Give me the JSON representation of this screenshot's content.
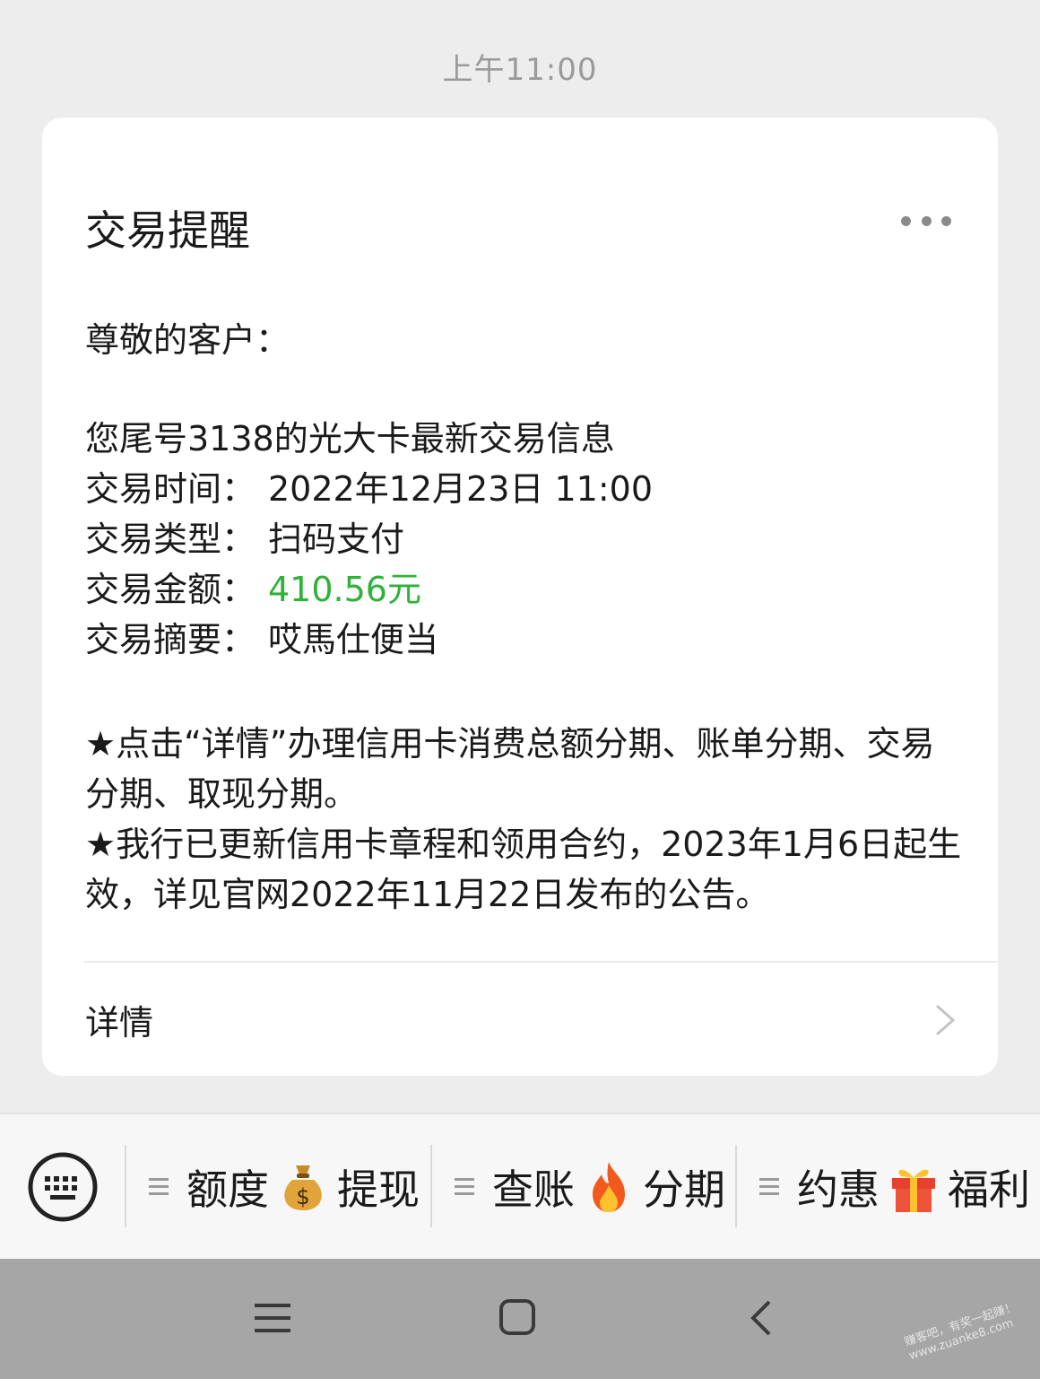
{
  "header": {
    "timestamp": "上午11:00"
  },
  "card": {
    "title": "交易提醒",
    "greeting": "尊敬的客户：",
    "intro": "您尾号3138的光大卡最新交易信息",
    "fields": [
      {
        "label": "交易时间：",
        "value": "2022年12月23日  11:00"
      },
      {
        "label": "交易类型：",
        "value": "扫码支付"
      },
      {
        "label": "交易金额：",
        "value": "410.56元"
      },
      {
        "label": "交易摘要：",
        "value": "哎馬仕便当"
      }
    ],
    "note1": "★点击“详情”办理信用卡消费总额分期、账单分期、交易分期、取现分期。",
    "note2": "★我行已更新信用卡章程和领用合约，2023年1月6日起生效，详见官网2022年11月22日发布的公告。",
    "details_label": "详情",
    "amount_color": "#2fb13a"
  },
  "menu": {
    "items": [
      {
        "left": "额度",
        "emoji": "money-bag-icon",
        "right": "提现"
      },
      {
        "left": "查账",
        "emoji": "fire-icon",
        "right": "分期"
      },
      {
        "left": "约惠",
        "emoji": "gift-icon",
        "right": "福利"
      }
    ]
  },
  "watermark": {
    "line1": "赚客吧，有奖一起赚！",
    "line2": "www.zuanke8.com"
  }
}
